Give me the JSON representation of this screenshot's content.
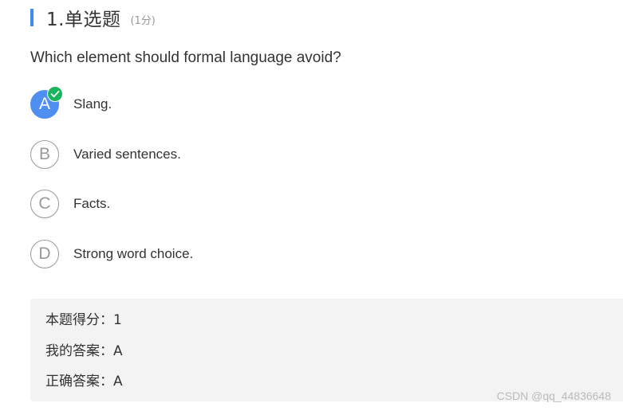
{
  "question": {
    "header_title": "1.单选题",
    "score_label": "(1分)",
    "text": "Which element should formal language avoid?"
  },
  "options": [
    {
      "letter": "A",
      "text": "Slang.",
      "selected": true
    },
    {
      "letter": "B",
      "text": "Varied sentences.",
      "selected": false
    },
    {
      "letter": "C",
      "text": "Facts.",
      "selected": false
    },
    {
      "letter": "D",
      "text": "Strong word choice.",
      "selected": false
    }
  ],
  "result": {
    "score_line": "本题得分：1",
    "my_answer_line": "我的答案：A",
    "correct_answer_line": "正确答案：A"
  },
  "watermark": "CSDN @qq_44836648",
  "colors": {
    "accent": "#3f8cf0",
    "selected_fill": "#4f8ff2",
    "check_badge": "#19b55c",
    "result_bg": "#f3f3f3"
  }
}
